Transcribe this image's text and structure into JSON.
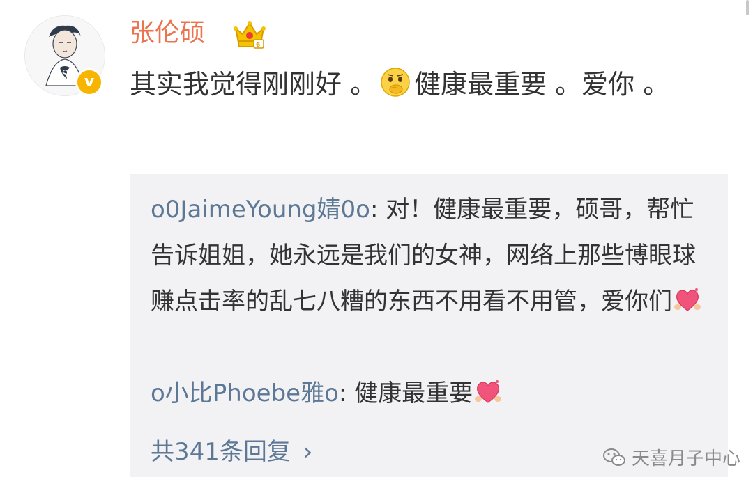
{
  "post": {
    "username": "张伦硕",
    "text_part1": "其实我觉得刚刚好 。",
    "text_part2": "健康最重要 。爱你 。",
    "crown_icon": "crown-vip-icon",
    "verified_icon": "verified-v-icon",
    "verified_glyph": "v",
    "inline_emoji": "thinking-face-emoji"
  },
  "comments": [
    {
      "author": "o0JaimeYoung婧0o",
      "separator": ": ",
      "text": "对！健康最重要，硕哥，帮忙告诉姐姐，她永远是我们的女神，网络上那些博眼球赚点击率的乱七八糟的东西不用看不用管，爱你们",
      "emoji": "love-heart-emoji"
    },
    {
      "author": "o小比Phoebe雅o",
      "separator": ": ",
      "text": "健康最重要",
      "emoji": "love-heart-emoji"
    }
  ],
  "more_replies": {
    "label": "共341条回复",
    "chevron": "›"
  },
  "watermark": {
    "icon": "wechat-icon",
    "text": "天喜月子中心"
  },
  "colors": {
    "username": "#eb7350",
    "link": "#5d7895",
    "text": "#333333",
    "comment_bg": "#f2f2f5",
    "verified": "#f8b500"
  }
}
